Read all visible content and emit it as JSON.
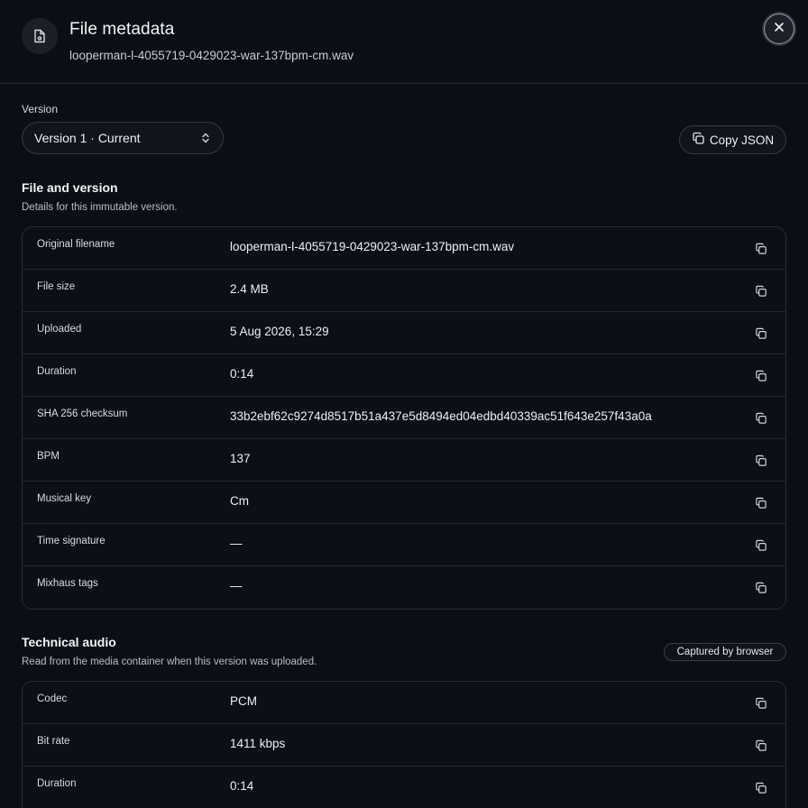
{
  "header": {
    "title": "File metadata",
    "subtitle": "looperman-l-4055719-0429023-war-137bpm-cm.wav"
  },
  "version": {
    "label": "Version",
    "selected": "Version 1 · Current"
  },
  "toolbar": {
    "copy_json_label": "Copy JSON"
  },
  "file_section": {
    "title": "File and version",
    "description": "Details for this immutable version.",
    "rows": [
      {
        "label": "Original filename",
        "value": "looperman-l-4055719-0429023-war-137bpm-cm.wav"
      },
      {
        "label": "File size",
        "value": "2.4 MB"
      },
      {
        "label": "Uploaded",
        "value": "5 Aug 2026, 15:29"
      },
      {
        "label": "Duration",
        "value": "0:14"
      },
      {
        "label": "SHA 256 checksum",
        "value": "33b2ebf62c9274d8517b51a437e5d8494ed04edbd40339ac51f643e257f43a0a"
      },
      {
        "label": "BPM",
        "value": "137"
      },
      {
        "label": "Musical key",
        "value": "Cm"
      },
      {
        "label": "Time signature",
        "value": "—"
      },
      {
        "label": "Mixhaus tags",
        "value": "—"
      }
    ]
  },
  "audio_section": {
    "title": "Technical audio",
    "description": "Read from the media container when this version was uploaded.",
    "badge": "Captured by browser",
    "rows": [
      {
        "label": "Codec",
        "value": "PCM"
      },
      {
        "label": "Bit rate",
        "value": "1411 kbps"
      },
      {
        "label": "Duration",
        "value": "0:14"
      }
    ]
  },
  "icons": {
    "header_icon": "file-audio-icon",
    "close": "close-icon",
    "select_chevron": "chevron-up-down-icon",
    "copy": "copy-icon"
  }
}
